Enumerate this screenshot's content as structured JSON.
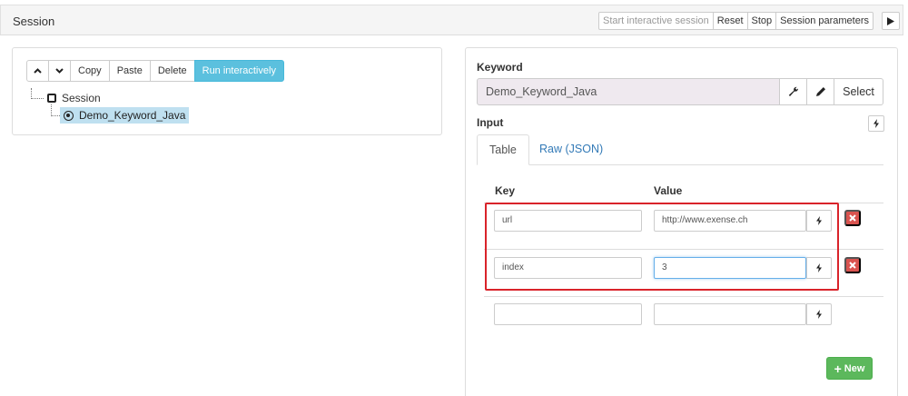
{
  "header": {
    "title": "Session",
    "buttons": {
      "start_interactive": "Start interactive session",
      "reset": "Reset",
      "stop": "Stop",
      "session_parameters": "Session parameters"
    },
    "play_icon": "play-icon"
  },
  "toolbar": {
    "up_icon": "chevron-up-icon",
    "down_icon": "chevron-down-icon",
    "copy": "Copy",
    "paste": "Paste",
    "delete": "Delete",
    "run_interactively": "Run interactively"
  },
  "tree": {
    "root": "Session",
    "child": "Demo_Keyword_Java"
  },
  "editor": {
    "keyword_label": "Keyword",
    "keyword_value": "Demo_Keyword_Java",
    "select_label": "Select",
    "input_label": "Input",
    "tabs": [
      {
        "label": "Table",
        "active": true
      },
      {
        "label": "Raw (JSON)",
        "active": false
      }
    ],
    "col_key": "Key",
    "col_value": "Value",
    "rows": [
      {
        "key": "url",
        "value": "http://www.exense.ch"
      },
      {
        "key": "index",
        "value": "3"
      },
      {
        "key": "",
        "value": ""
      }
    ],
    "new_label": "New"
  },
  "colors": {
    "accent_info": "#5bc0de",
    "danger": "#d9534f",
    "success": "#5cb85c",
    "highlight": "#d9232a",
    "link": "#337ab7"
  }
}
